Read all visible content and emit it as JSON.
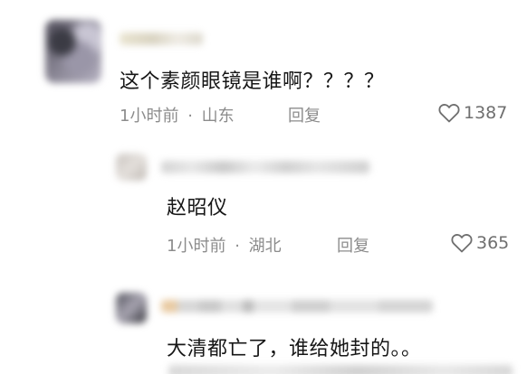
{
  "comments": [
    {
      "text": "这个素颜眼镜是谁啊？？？？",
      "time": "1小时前",
      "separator": "·",
      "location": "山东",
      "reply_label": "回复",
      "likes": "1387",
      "like_icon": "heart-outline-icon"
    },
    {
      "text": "赵昭仪",
      "time": "1小时前",
      "separator": "·",
      "location": "湖北",
      "reply_label": "回复",
      "likes": "365",
      "like_icon": "heart-outline-icon"
    },
    {
      "text": "大清都亡了，谁给她封的。。"
    }
  ],
  "colors": {
    "text": "#161616",
    "meta": "#8c8c8c",
    "background": "#ffffff"
  }
}
